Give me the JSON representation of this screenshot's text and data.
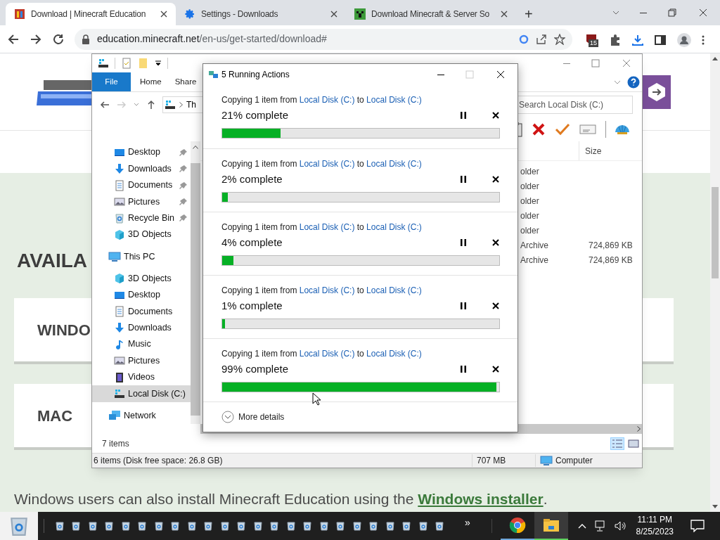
{
  "browser": {
    "tabs": [
      {
        "title": "Download | Minecraft Education",
        "selected": true,
        "kind": "minecraft"
      },
      {
        "title": "Settings - Downloads",
        "selected": false,
        "kind": "settings"
      },
      {
        "title": "Download Minecraft & Server So",
        "selected": false,
        "kind": "creeper"
      }
    ],
    "new_tab": "+",
    "url_host": "education.minecraft.net",
    "url_path": "/en-us/get-started/download#",
    "extension_badge": "15"
  },
  "page": {
    "heading": "AVAILA",
    "cards": [
      "WINDO",
      "MAC"
    ],
    "note": "Windows users can also install Minecraft Education using the",
    "note_link": "Windows installer",
    "note_end": "."
  },
  "explorer": {
    "ribbon_tabs": [
      {
        "label": "File",
        "selected": true
      },
      {
        "label": "Home",
        "selected": false
      },
      {
        "label": "Share",
        "selected": false
      }
    ],
    "address": "Th",
    "search_placeholder": "Search Local Disk (C:)",
    "size_header": "Size",
    "rows": [
      {
        "type": "older",
        "size": ""
      },
      {
        "type": "older",
        "size": ""
      },
      {
        "type": "older",
        "size": ""
      },
      {
        "type": "older",
        "size": ""
      },
      {
        "type": "older",
        "size": ""
      },
      {
        "type": "Archive",
        "size": "724,869 KB"
      },
      {
        "type": "Archive",
        "size": "724,869 KB"
      }
    ],
    "nav": [
      {
        "label": "Desktop",
        "kind": "desktop",
        "pinned": true,
        "selected": false
      },
      {
        "label": "Downloads",
        "kind": "downloads",
        "pinned": true,
        "selected": false
      },
      {
        "label": "Documents",
        "kind": "documents",
        "pinned": true,
        "selected": false
      },
      {
        "label": "Pictures",
        "kind": "pictures",
        "pinned": true,
        "selected": false
      },
      {
        "label": "Recycle Bin",
        "kind": "recycle",
        "pinned": true,
        "selected": false
      },
      {
        "label": "3D Objects",
        "kind": "objects",
        "pinned": false,
        "selected": false
      },
      {
        "label": "This PC",
        "kind": "pc",
        "pinned": false,
        "selected": false,
        "children": [
          {
            "label": "3D Objects",
            "kind": "objects",
            "pinned": false,
            "selected": false
          },
          {
            "label": "Desktop",
            "kind": "desktop",
            "pinned": false,
            "selected": false
          },
          {
            "label": "Documents",
            "kind": "documents",
            "pinned": false,
            "selected": false
          },
          {
            "label": "Downloads",
            "kind": "downloads",
            "pinned": false,
            "selected": false
          },
          {
            "label": "Music",
            "kind": "music",
            "pinned": false,
            "selected": false
          },
          {
            "label": "Pictures",
            "kind": "pictures",
            "pinned": false,
            "selected": false
          },
          {
            "label": "Videos",
            "kind": "videos",
            "pinned": false,
            "selected": false
          },
          {
            "label": "Local Disk (C:)",
            "kind": "disk",
            "pinned": false,
            "selected": true
          }
        ]
      },
      {
        "label": "Network",
        "kind": "network",
        "pinned": false,
        "selected": false
      }
    ],
    "item_count": "7 items",
    "status": "6 items (Disk free space: 26.8 GB)",
    "status_size": "707 MB",
    "status_location": "Computer"
  },
  "dialog": {
    "title": "5 Running Actions",
    "more_details": "More details",
    "actions": [
      {
        "prefix": "Copying 1 item from",
        "source": "Local Disk (C:)",
        "middle": "to",
        "dest": "Local Disk (C:)",
        "progress": "21% complete",
        "level": 0.21
      },
      {
        "prefix": "Copying 1 item from",
        "source": "Local Disk (C:)",
        "middle": "to",
        "dest": "Local Disk (C:)",
        "progress": "2% complete",
        "level": 0.02
      },
      {
        "prefix": "Copying 1 item from",
        "source": "Local Disk (C:)",
        "middle": "to",
        "dest": "Local Disk (C:)",
        "progress": "4% complete",
        "level": 0.04
      },
      {
        "prefix": "Copying 1 item from",
        "source": "Local Disk (C:)",
        "middle": "to",
        "dest": "Local Disk (C:)",
        "progress": "1% complete",
        "level": 0.01
      },
      {
        "prefix": "Copying 1 item from",
        "source": "Local Disk (C:)",
        "middle": "to",
        "dest": "Local Disk (C:)",
        "progress": "99% complete",
        "level": 0.99
      }
    ]
  },
  "taskbar": {
    "overflow": "»",
    "time": "11:11 PM",
    "date": "8/25/2023",
    "pinned_apps": [
      {
        "kind": "chrome",
        "selected": false
      },
      {
        "kind": "explorer",
        "selected": true
      }
    ]
  }
}
